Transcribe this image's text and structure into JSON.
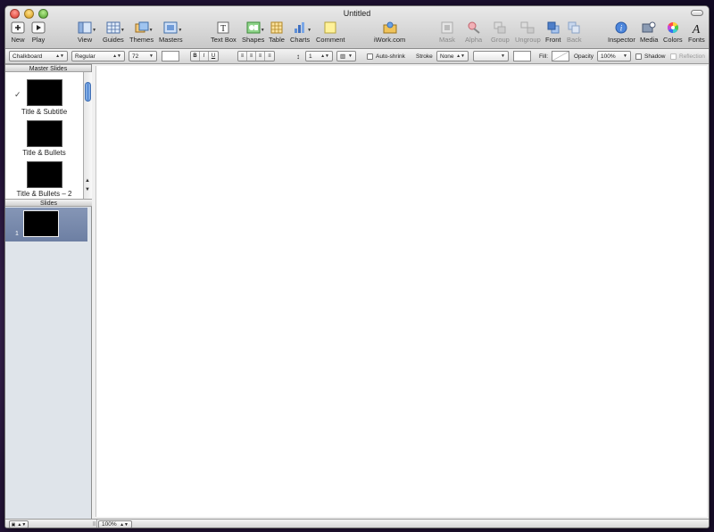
{
  "window": {
    "title": "Untitled"
  },
  "toolbar": {
    "new": "New",
    "play": "Play",
    "view": "View",
    "guides": "Guides",
    "themes": "Themes",
    "masters": "Masters",
    "text_box": "Text Box",
    "shapes": "Shapes",
    "table": "Table",
    "charts": "Charts",
    "comment": "Comment",
    "iwork": "iWork.com",
    "mask": "Mask",
    "alpha": "Alpha",
    "group": "Group",
    "ungroup": "Ungroup",
    "front": "Front",
    "back": "Back",
    "inspector": "Inspector",
    "media": "Media",
    "colors": "Colors",
    "fonts": "Fonts"
  },
  "format_bar": {
    "font_family": "Chalkboard",
    "font_style": "Regular",
    "font_size": "72",
    "bold": "B",
    "italic": "I",
    "underline": "U",
    "line_spacing": "1",
    "auto_shrink": "Auto-shrink",
    "stroke_label": "Stroke",
    "stroke_value": "None",
    "fill_label": "Fill:",
    "opacity_label": "Opacity",
    "opacity_value": "100%",
    "shadow": "Shadow",
    "reflection": "Reflection"
  },
  "sidebar": {
    "master_header": "Master Slides",
    "masters": [
      {
        "label": "Title & Subtitle",
        "selected": true
      },
      {
        "label": "Title & Bullets"
      },
      {
        "label": "Title & Bullets – 2"
      }
    ],
    "slides_header": "Slides",
    "slides": [
      {
        "number": "1"
      }
    ]
  },
  "status": {
    "zoom": "100%"
  },
  "colors": {
    "selection": "#7586a9",
    "scroll_thumb": "#4f86d4"
  }
}
